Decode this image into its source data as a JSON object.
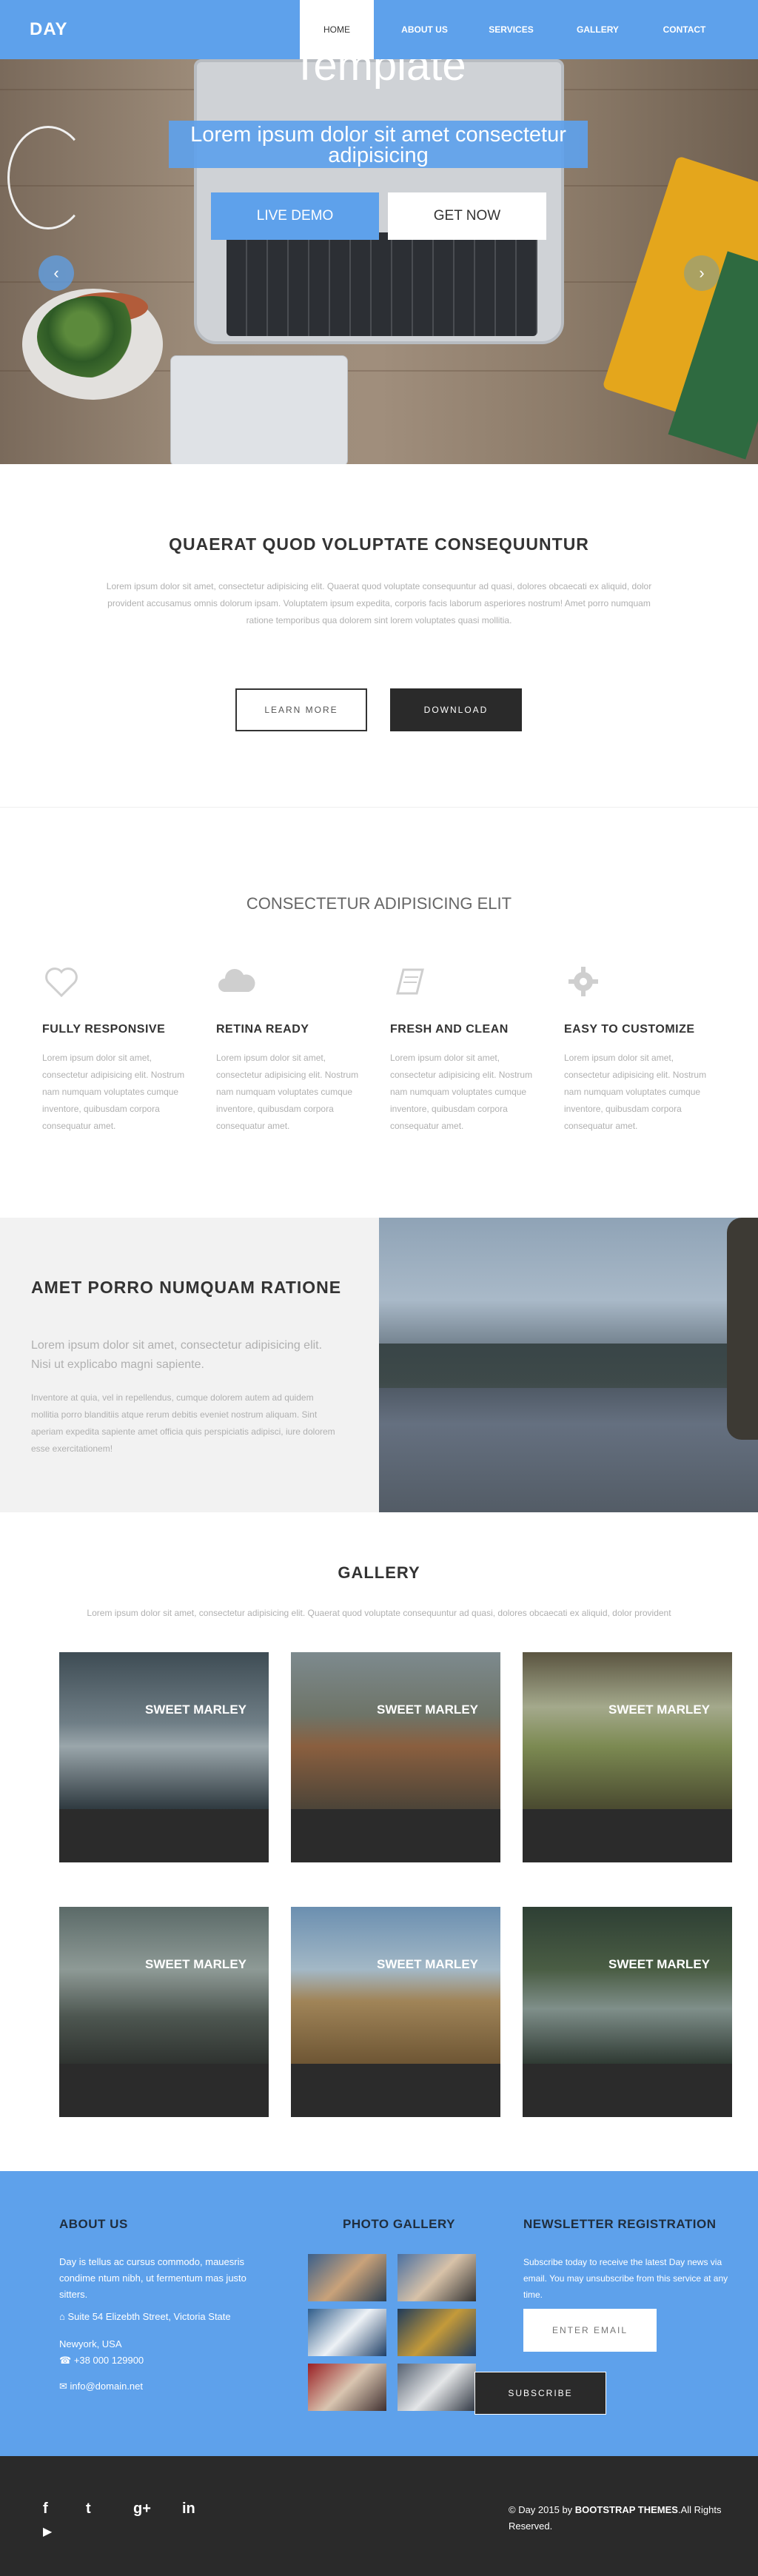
{
  "nav": {
    "logo": "DAY",
    "items": [
      {
        "label": "HOME"
      },
      {
        "label": "ABOUT US"
      },
      {
        "label": "SERVICES"
      },
      {
        "label": "GALLERY"
      },
      {
        "label": "CONTACT"
      }
    ]
  },
  "hero": {
    "title": "Template",
    "subtitle": "Lorem ipsum dolor sit amet consectetur adipisicing",
    "primary_button": "LIVE DEMO",
    "secondary_button": "GET NOW",
    "prev_arrow": "‹",
    "next_arrow": "›"
  },
  "intro": {
    "title": "QUAERAT QUOD VOLUPTATE CONSEQUUNTUR",
    "text": "Lorem ipsum dolor sit amet, consectetur adipisicing elit. Quaerat quod voluptate consequuntur ad quasi, dolores obcaecati ex aliquid, dolor provident accusamus omnis dolorum ipsam. Voluptatem ipsum expedita, corporis facis laborum asperiores nostrum! Amet porro numquam ratione temporibus qua dolorem sint lorem voluptates quasi mollitia.",
    "learn_button": "LEARN MORE",
    "download_button": "DOWNLOAD"
  },
  "features": {
    "title": "CONSECTETUR ADIPISICING ELIT",
    "items": [
      {
        "icon": "heart-icon",
        "heading": "FULLY RESPONSIVE",
        "text": "Lorem ipsum dolor sit amet, consectetur adipisicing elit. Nostrum nam numquam voluptates cumque inventore, quibusdam corpora consequatur amet."
      },
      {
        "icon": "cloud-icon",
        "heading": "RETINA READY",
        "text": "Lorem ipsum dolor sit amet, consectetur adipisicing elit. Nostrum nam numquam voluptates cumque inventore, quibusdam corpora consequatur amet."
      },
      {
        "icon": "book-icon",
        "heading": "FRESH AND CLEAN",
        "text": "Lorem ipsum dolor sit amet, consectetur adipisicing elit. Nostrum nam numquam voluptates cumque inventore, quibusdam corpora consequatur amet."
      },
      {
        "icon": "gear-icon",
        "heading": "EASY TO CUSTOMIZE",
        "text": "Lorem ipsum dolor sit amet, consectetur adipisicing elit. Nostrum nam numquam voluptates cumque inventore, quibusdam corpora consequatur amet."
      }
    ]
  },
  "split": {
    "title": "AMET PORRO NUMQUAM RATIONE",
    "lead": "Lorem ipsum dolor sit amet, consectetur adipisicing elit. Nisi ut explicabo magni sapiente.",
    "text": "Inventore at quia, vel in repellendus, cumque dolorem autem ad quidem mollitia porro blanditiis atque rerum debitis eveniet nostrum aliquam. Sint aperiam expedita sapiente amet officia quis perspiciatis adipisci, iure dolorem esse exercitationem!"
  },
  "gallery": {
    "title": "GALLERY",
    "text": "Lorem ipsum dolor sit amet, consectetur adipisicing elit. Quaerat quod voluptate consequuntur ad quasi, dolores obcaecati ex aliquid, dolor provident",
    "items": [
      {
        "label": "SWEET MARLEY"
      },
      {
        "label": "SWEET MARLEY"
      },
      {
        "label": "SWEET MARLEY"
      },
      {
        "label": "SWEET MARLEY"
      },
      {
        "label": "SWEET MARLEY"
      },
      {
        "label": "SWEET MARLEY"
      }
    ]
  },
  "footer": {
    "about": {
      "title": "ABOUT US",
      "text": "Day is tellus ac cursus commodo, mauesris condime ntum nibh, ut fermentum mas justo sitters.",
      "address": "Suite 54 Elizebth Street, Victoria State",
      "city": "Newyork, USA",
      "phone": "+38 000 129900",
      "email": "info@domain.net"
    },
    "photo_gallery": {
      "title": "PHOTO GALLERY"
    },
    "newsletter": {
      "title": "NEWSLETTER REGISTRATION",
      "text": "Subscribe today to receive the latest Day news via email. You may unsubscribe from this service at any time.",
      "placeholder": "ENTER EMAIL",
      "button": "SUBSCRIBE"
    }
  },
  "bottom": {
    "social": {
      "facebook": "f",
      "twitter": "t",
      "googleplus": "g+",
      "linkedin": "in",
      "youtube": "▶"
    },
    "copyright_prefix": "© Day 2015 by ",
    "copyright_brand": "BOOTSTRAP THEMES",
    "copyright_suffix": ".All Rights Reserved."
  },
  "colors": {
    "accent": "#5ea1eb",
    "dark": "#2a2a2a",
    "muted_text": "#b0b0b0"
  }
}
